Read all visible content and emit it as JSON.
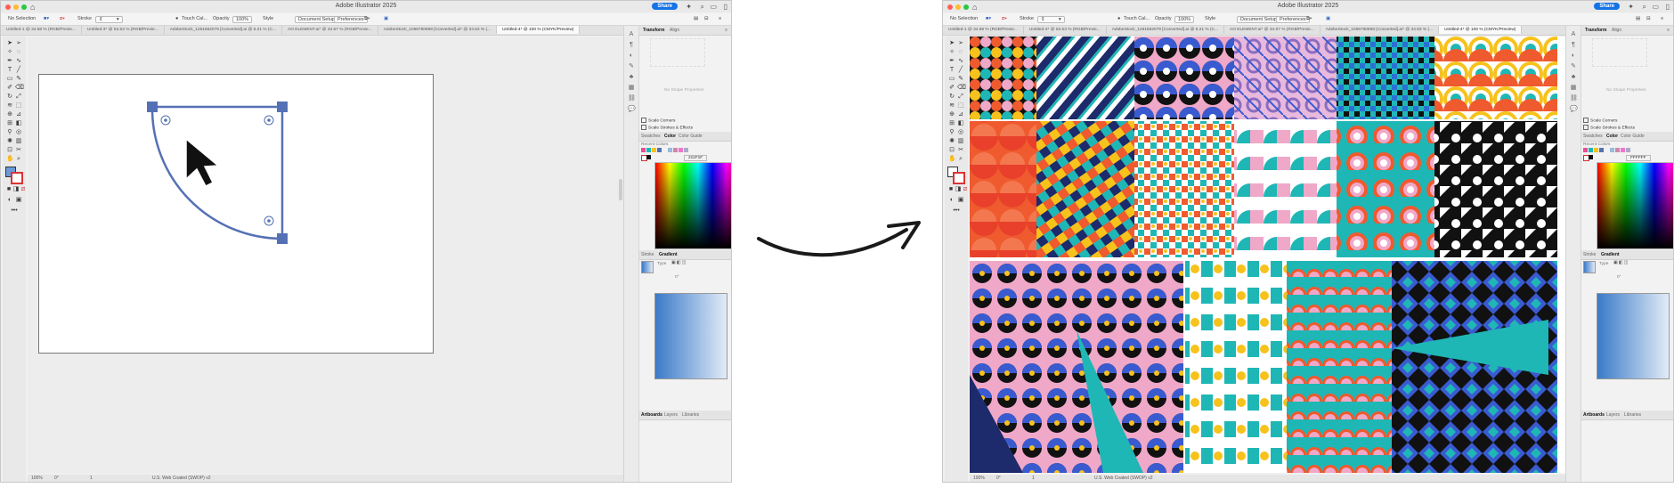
{
  "app_title": "Adobe Illustrator 2025",
  "share_label": "Share",
  "control_bar": {
    "selection": "No Selection",
    "stroke_label": "Stroke",
    "brush": "Touch Cal...",
    "opacity_label": "Opacity",
    "opacity_value": "100%",
    "style_label": "Style",
    "doc_setup": "Document Setup",
    "preferences": "Preferences"
  },
  "left_window": {
    "tabs": [
      {
        "label": "Untitled-1 @ 34.58 % (RGB/Previe..."
      },
      {
        "label": "Untitled-3* @ 53.53 % (RGB/Previe..."
      },
      {
        "label": "AdobeStock_1251562079 [Converted].ai @ 6.21 % (C..."
      },
      {
        "label": "AO ELEMENT.ai* @ 34.67 % (RGB/Previe..."
      },
      {
        "label": "AdobeStock_1066760969 [Converted].ai* @ 34.63 % (..."
      },
      {
        "label": "Untitled-4* @ 100 % (CMYK/Preview)"
      }
    ],
    "active_tab": 5,
    "zoom": "100%",
    "angle": "0°",
    "page": "1",
    "status_text": "U.S. Web Coated (SWOP) v2"
  },
  "right_window": {
    "tabs": [
      {
        "label": "Untitled-1 @ 34.58 % (RGB/Previe..."
      },
      {
        "label": "Untitled-3* @ 53.53 % (RGB/Previe..."
      },
      {
        "label": "AdobeStock_1251562079 [Converted].ai @ 6.21 % (C..."
      },
      {
        "label": "AO ELEMENT.ai* @ 34.67 % (RGB/Previe..."
      },
      {
        "label": "AdobeStock_1066760969 [Converted].ai* @ 34.63 % (..."
      },
      {
        "label": "Untitled-4* @ 100 % (CMYK/Preview)"
      }
    ],
    "active_tab": 5,
    "zoom": "100%",
    "angle": "0°",
    "page": "1",
    "status_text": "U.S. Web Coated (SWOP) v2"
  },
  "panels": {
    "transform_tab": "Transform",
    "align_tab": "Align",
    "no_shape": "No Shape Properties",
    "scale_corners": "Scale Corners",
    "scale_strokes": "Scale Strokes & Effects",
    "swatches_tab": "Swatches",
    "color_tab": "Color",
    "color_guide_tab": "Color Guide",
    "recent_colors": "Recent Colors",
    "hex_left": "211F1F",
    "hex_right": "FFFFFF",
    "stroke_tab": "Stroke",
    "gradient_tab": "Gradient",
    "type_label": "Type",
    "angle_value": "0°",
    "artboards_tab": "Artboards",
    "layers_tab": "Layers",
    "libraries_tab": "Libraries"
  },
  "colors": {
    "selection_blue": "#5571b5",
    "pattern_pink": "#f0a8c8",
    "pattern_orange": "#ef5a2f",
    "pattern_teal": "#1fb7b5",
    "pattern_navy": "#1d2a6b",
    "pattern_yellow": "#f7c21c"
  },
  "icons": [
    "selection-tool-icon",
    "direct-selection-tool-icon",
    "pen-tool-icon",
    "type-tool-icon",
    "rectangle-tool-icon",
    "hand-tool-icon",
    "zoom-tool-icon",
    "arrow-cursor-icon"
  ]
}
